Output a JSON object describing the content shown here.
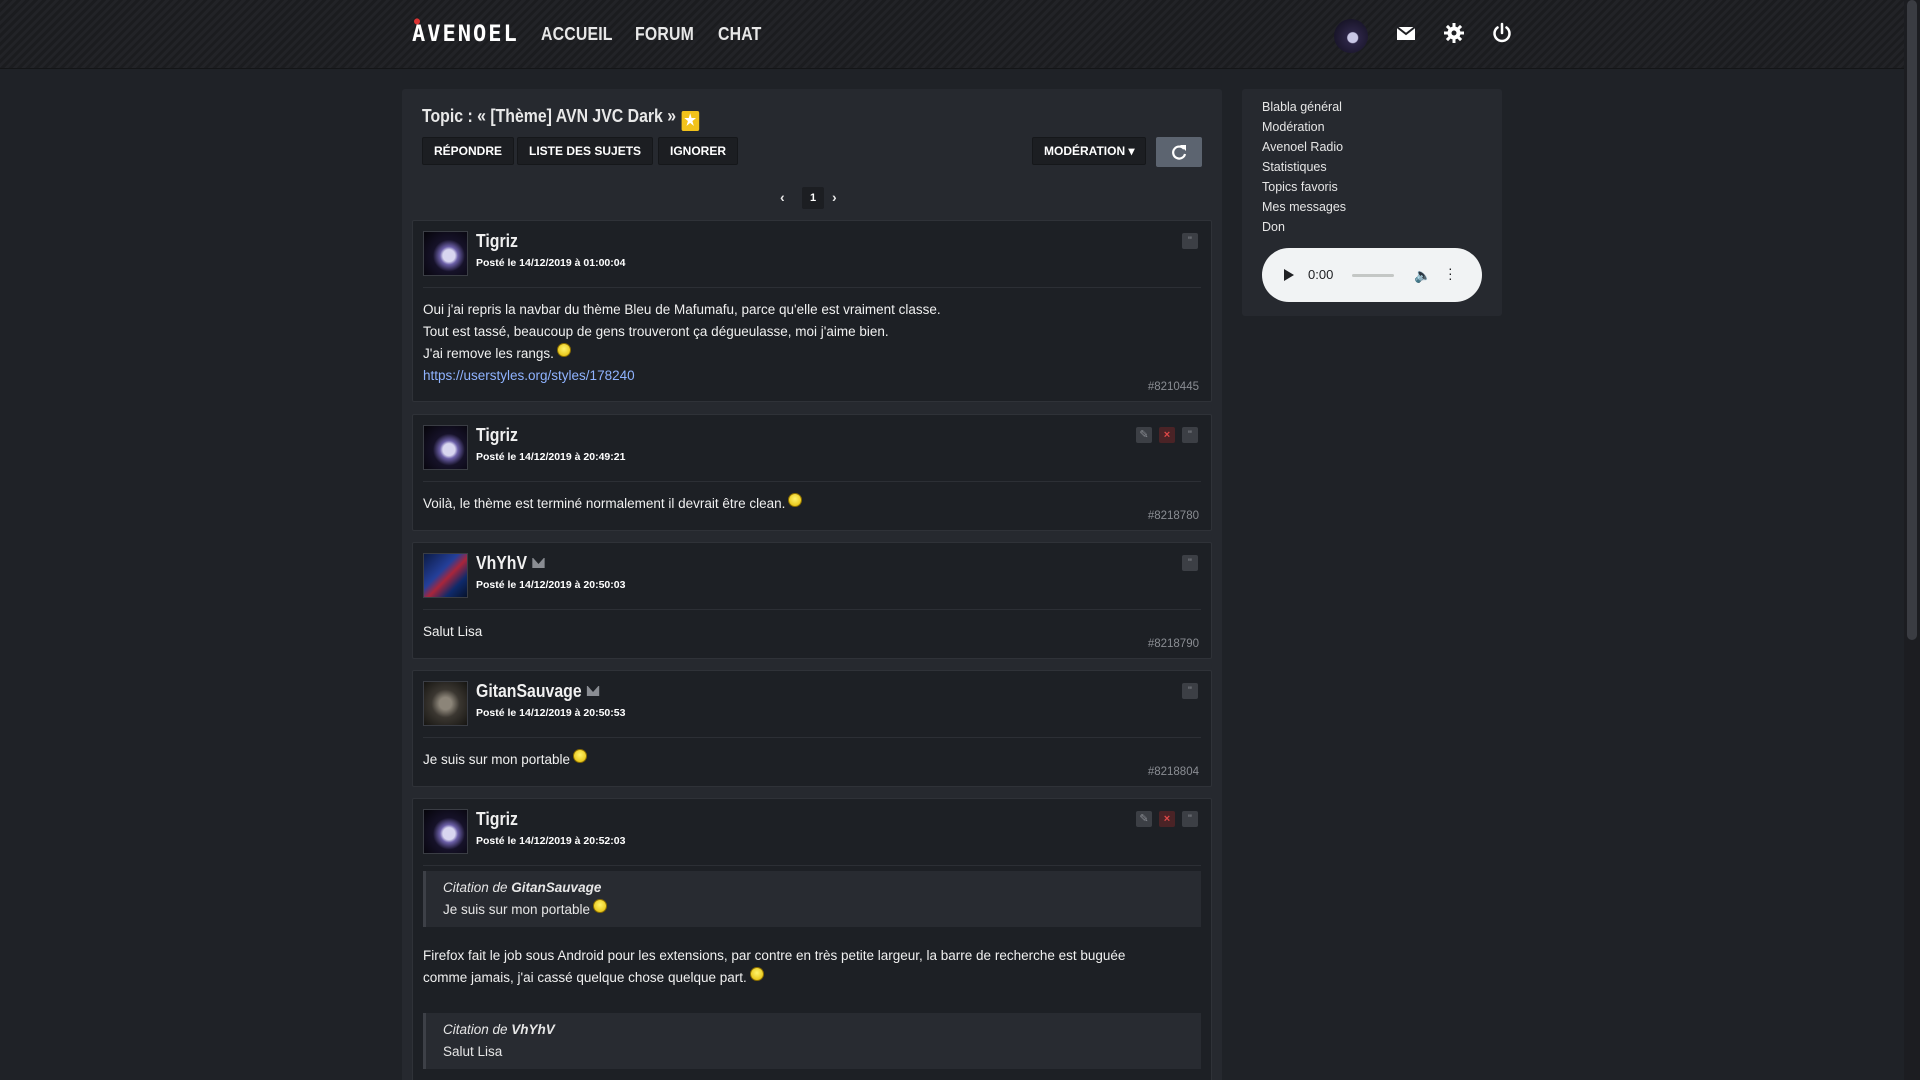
{
  "nav": {
    "logo": "AVENOEL",
    "links": [
      "ACCUEIL",
      "FORUM",
      "CHAT"
    ],
    "icons": [
      "avatar",
      "mail-icon",
      "gear-icon",
      "power-icon"
    ]
  },
  "topic": {
    "title": "Topic : « [Thème] AVN JVC Dark »",
    "buttons": {
      "reply": "RÉPONDRE",
      "list": "LISTE DES SUJETS",
      "ignore": "IGNORER",
      "moderation": "MODÉRATION ▾"
    },
    "page": "1"
  },
  "posts": [
    {
      "author": "Tigriz",
      "date": "Posté le 14/12/2019 à 01:00:04",
      "lines": [
        "Oui j'ai repris la navbar du thème Bleu de Mafumafu, parce qu'elle est vraiment classe.",
        "Tout est tassé, beaucoup de gens trouveront ça dégueulasse, moi j'aime bien.",
        "J'ai remove les rangs."
      ],
      "link": "https://userstyles.org/styles/178240",
      "id": "#8210445"
    },
    {
      "author": "Tigriz",
      "date": "Posté le 14/12/2019 à 20:49:21",
      "lines": [
        "Voilà, le thème est terminé normalement il devrait être clean."
      ],
      "id": "#8218780"
    },
    {
      "author": "VhYhV",
      "date": "Posté le 14/12/2019 à 20:50:03",
      "lines": [
        "Salut Lisa"
      ],
      "id": "#8218790"
    },
    {
      "author": "GitanSauvage",
      "date": "Posté le 14/12/2019 à 20:50:53",
      "lines": [
        "Je suis sur mon portable"
      ],
      "id": "#8218804"
    },
    {
      "author": "Tigriz",
      "date": "Posté le 14/12/2019 à 20:52:03",
      "quote1": {
        "head": "Citation de ",
        "who": "GitanSauvage",
        "text": "Je suis sur mon portable"
      },
      "lines": [
        "Firefox fait le job sous Android pour les extensions, par contre en très petite largeur, la barre de recherche est buguée",
        "comme jamais, j'ai cassé quelque chose quelque part."
      ],
      "quote2": {
        "head": "Citation de ",
        "who": "VhYhV",
        "text": "Salut Lisa"
      }
    }
  ],
  "sidebar": {
    "links": [
      "Blabla général",
      "Modération",
      "Avenoel Radio",
      "Statistiques",
      "Topics favoris",
      "Mes messages",
      "Don"
    ],
    "audio_time": "0:00"
  }
}
